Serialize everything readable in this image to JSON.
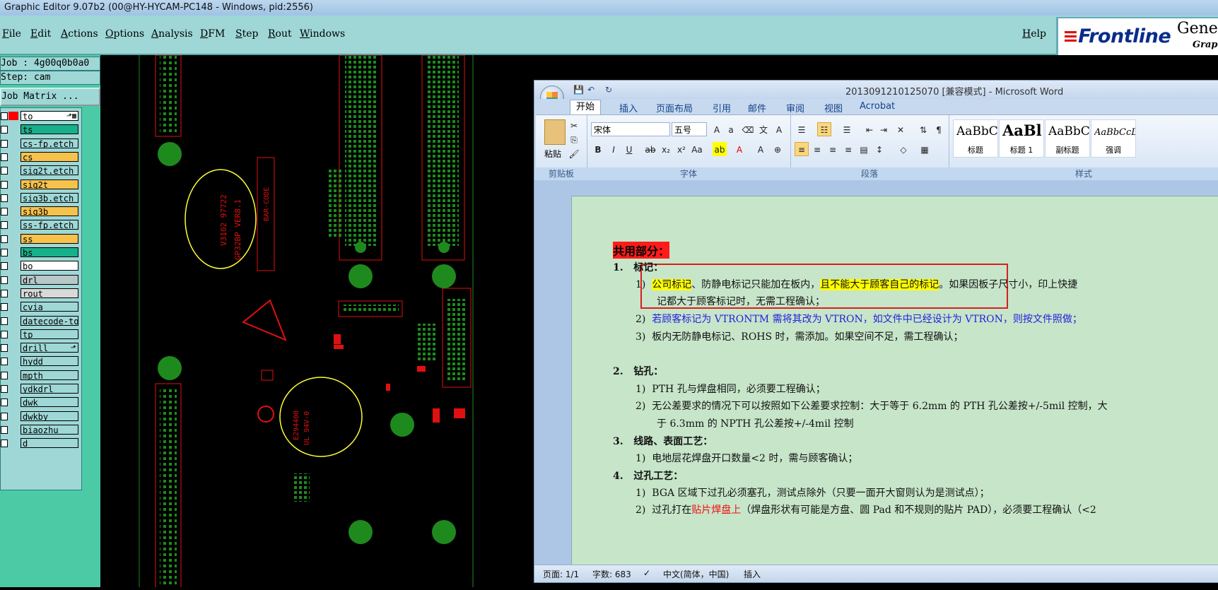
{
  "window": {
    "title": "Graphic Editor 9.07b2 (00@HY-HYCAM-PC148 - Windows, pid:2556)"
  },
  "menu": {
    "items": [
      "File",
      "Edit",
      "Actions",
      "Options",
      "Analysis",
      "DFM",
      "Step",
      "Rout",
      "Windows"
    ],
    "help": "Help"
  },
  "logo": {
    "brand": "Frontline",
    "product": "Genes",
    "sub": "Graph"
  },
  "info": {
    "job": "Job : 4g00q0b0a0",
    "step": "Step: cam",
    "job_matrix": "Job Matrix ..."
  },
  "layers": [
    {
      "name": "to",
      "color": "#ffffff",
      "swatch": "#ff0000",
      "marker": "⬏▦"
    },
    {
      "name": "ts",
      "color": "#18b08a",
      "swatch": "",
      "marker": ""
    },
    {
      "name": "cs-fp.etch",
      "color": "#9ed7d6",
      "swatch": "",
      "marker": ""
    },
    {
      "name": "cs",
      "color": "#f7c24c",
      "swatch": "",
      "marker": ""
    },
    {
      "name": "sig2t.etch",
      "color": "#9ed7d6",
      "swatch": "",
      "marker": ""
    },
    {
      "name": "sig2t",
      "color": "#f7c24c",
      "swatch": "",
      "marker": ""
    },
    {
      "name": "sig3b.etch",
      "color": "#9ed7d6",
      "swatch": "",
      "marker": ""
    },
    {
      "name": "sig3b",
      "color": "#f7c24c",
      "swatch": "",
      "marker": ""
    },
    {
      "name": "ss-fp.etch",
      "color": "#9ed7d6",
      "swatch": "",
      "marker": ""
    },
    {
      "name": "ss",
      "color": "#f7c24c",
      "swatch": "",
      "marker": ""
    },
    {
      "name": "bs",
      "color": "#18b08a",
      "swatch": "",
      "marker": ""
    },
    {
      "name": "bo",
      "color": "#ffffff",
      "swatch": "",
      "marker": ""
    },
    {
      "name": "drl",
      "color": "#b8c7c8",
      "swatch": "",
      "marker": ""
    },
    {
      "name": "rout",
      "color": "#d9d9d9",
      "swatch": "",
      "marker": ""
    },
    {
      "name": "cvia",
      "color": "#9ed7d6",
      "swatch": "",
      "marker": ""
    },
    {
      "name": "datecode-to",
      "color": "#9ed7d6",
      "swatch": "",
      "marker": ""
    },
    {
      "name": "tp",
      "color": "#9ed7d6",
      "swatch": "",
      "marker": ""
    },
    {
      "name": "drill",
      "color": "#9ed7d6",
      "swatch": "",
      "marker": "⬏"
    },
    {
      "name": "hydd",
      "color": "#9ed7d6",
      "swatch": "",
      "marker": ""
    },
    {
      "name": "mpth",
      "color": "#9ed7d6",
      "swatch": "",
      "marker": ""
    },
    {
      "name": "ydkdrl",
      "color": "#9ed7d6",
      "swatch": "",
      "marker": ""
    },
    {
      "name": "dwk",
      "color": "#9ed7d6",
      "swatch": "",
      "marker": ""
    },
    {
      "name": "dwkby",
      "color": "#9ed7d6",
      "swatch": "",
      "marker": ""
    },
    {
      "name": "biaozhu",
      "color": "#9ed7d6",
      "swatch": "",
      "marker": ""
    },
    {
      "name": "d",
      "color": "#9ed7d6",
      "swatch": "",
      "marker": ""
    }
  ],
  "pcb": {
    "text1": "V3102 97722",
    "text2": "GP32BP VER8.1",
    "text3": "BAR-CODE",
    "text4": "E294400",
    "text5": "UL 94V-0"
  },
  "word": {
    "title": "2013091210125070 [兼容模式] - Microsoft Word",
    "tabs": [
      "开始",
      "插入",
      "页面布局",
      "引用",
      "邮件",
      "审阅",
      "视图",
      "Acrobat"
    ],
    "font": "宋体",
    "size": "五号",
    "paste": "粘贴",
    "groups": [
      "剪贴板",
      "字体",
      "段落",
      "样式"
    ],
    "styles": [
      {
        "preview": "AaBbC",
        "name": "标题"
      },
      {
        "preview": "AaBl",
        "name": "标题 1"
      },
      {
        "preview": "AaBbC",
        "name": "副标题"
      },
      {
        "preview": "AaBbCcDc",
        "name": "强调"
      }
    ],
    "status": {
      "page": "页面: 1/1",
      "words": "字数: 683",
      "lang": "中文(简体，中国)",
      "mode": "插入"
    },
    "doc": {
      "heading": "共用部分：",
      "s1": "标记：",
      "s1_1a": "公司标记",
      "s1_1b": "、防静电标记只能加在板内，",
      "s1_1c": "且不能大于顾客自己的标记",
      "s1_1d": "。如果因板子尺寸小，印上快捷",
      "s1_1e": "记都大于顾客标记时，无需工程确认；",
      "s1_2": "若顾客标记为 VTRONTM 需将其改为 VTRON，如文件中已经设计为 VTRON，则按文件照做；",
      "s1_3": "板内无防静电标记、ROHS 时，需添加。如果空间不足，需工程确认；",
      "s2": "钻孔：",
      "s2_1": "PTH 孔与焊盘相同，必须要工程确认；",
      "s2_2a": "无公差要求的情况下可以按照如下公差要求控制：大于等于 6.2mm 的 PTH 孔公差按+/-5mil 控制，大",
      "s2_2b": "于 6.3mm 的 NPTH 孔公差按+/-4mil 控制",
      "s3": "线路、表面工艺：",
      "s3_1": "电地层花焊盘开口数量<2 时，需与顾客确认；",
      "s4": "过孔工艺：",
      "s4_1": "BGA 区域下过孔必须塞孔，测试点除外（只要一面开大窗则认为是测试点）；",
      "s4_2a": "过孔打在",
      "s4_2b": "贴片焊盘上",
      "s4_2c": "（焊盘形状有可能是方盘、圆 Pad 和不规则的贴片 PAD），必须要工程确认（<2"
    }
  },
  "colors": {
    "accent": "#9ed7d6",
    "panel": "#4ccaa6",
    "pcb_green": "#1e8a1e",
    "pcb_red": "#e01010",
    "pcb_yellow": "#ffff33"
  }
}
